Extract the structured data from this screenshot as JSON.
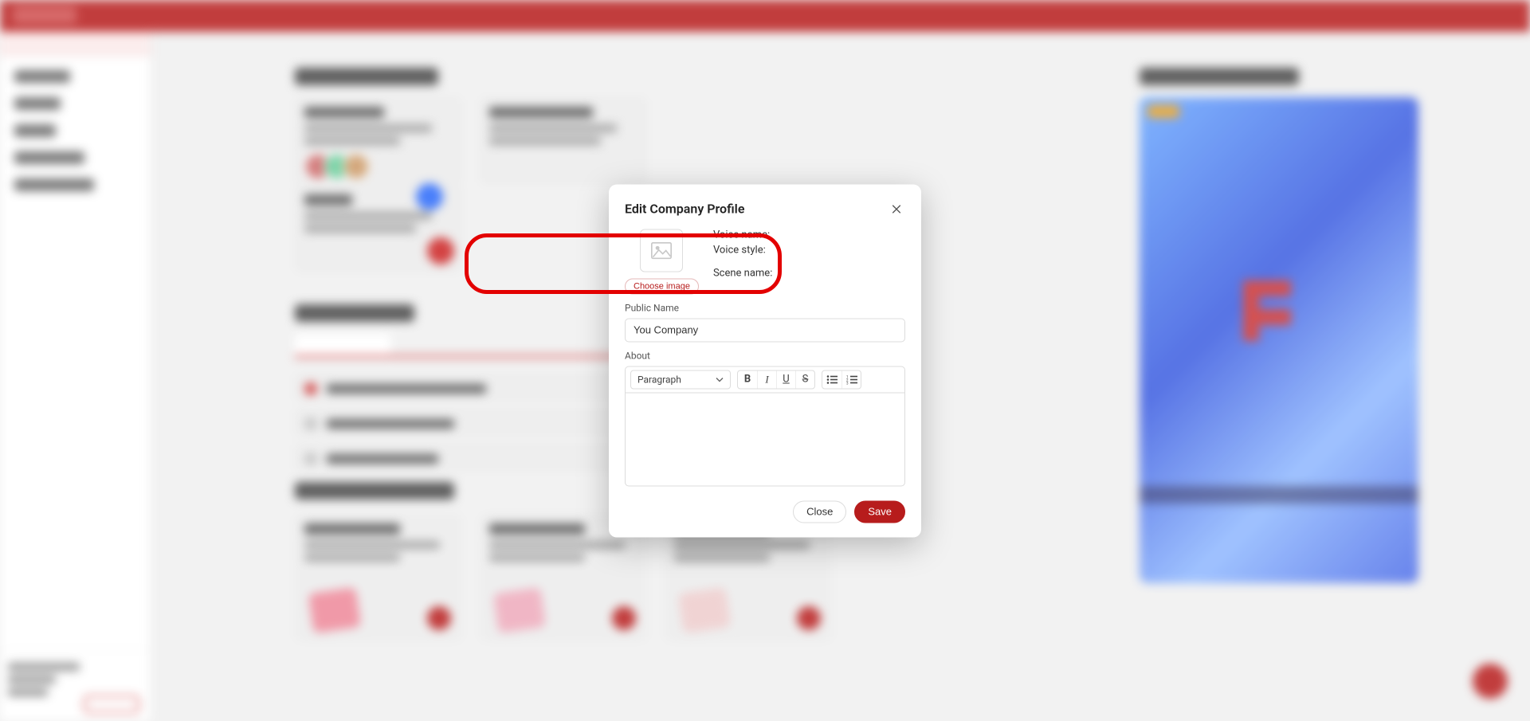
{
  "modal": {
    "title": "Edit Company Profile",
    "voice_name_label": "Voice name:",
    "voice_style_label": "Voice style:",
    "scene_name_label": "Scene name:",
    "choose_image": "Choose image",
    "public_name_label": "Public Name",
    "public_name_value": "You Company",
    "about_label": "About",
    "paragraph_label": "Paragraph",
    "close": "Close",
    "save": "Save"
  }
}
